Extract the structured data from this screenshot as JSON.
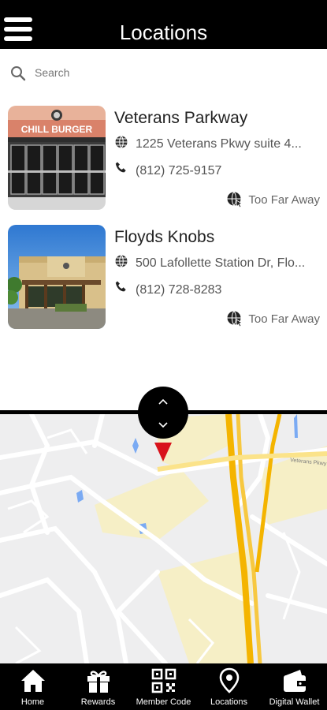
{
  "header": {
    "title": "Locations"
  },
  "search": {
    "placeholder": "Search"
  },
  "locations": [
    {
      "name": "Veterans Parkway",
      "address": "1225 Veterans Pkwy suite 4...",
      "phone": "(812) 725-9157",
      "distance_status": "Too Far Away",
      "sign_text": "CHILL BURGER"
    },
    {
      "name": "Floyds Knobs",
      "address": "500 Lafollette Station Dr, Flo...",
      "phone": "(812) 728-8283",
      "distance_status": "Too Far Away"
    }
  ],
  "map": {
    "road_label": "Veterans Pkwy"
  },
  "tabs": [
    {
      "label": "Home",
      "icon": "home-icon"
    },
    {
      "label": "Rewards",
      "icon": "gift-icon"
    },
    {
      "label": "Member Code",
      "icon": "qr-code-icon"
    },
    {
      "label": "Locations",
      "icon": "map-pin-icon"
    },
    {
      "label": "Digital Wallet",
      "icon": "wallet-icon"
    }
  ],
  "colors": {
    "header_bg": "#000000",
    "marker": "#d8121b",
    "highway": "#f4b400",
    "water": "#7aaaf3",
    "map_bg": "#eeeeef"
  }
}
